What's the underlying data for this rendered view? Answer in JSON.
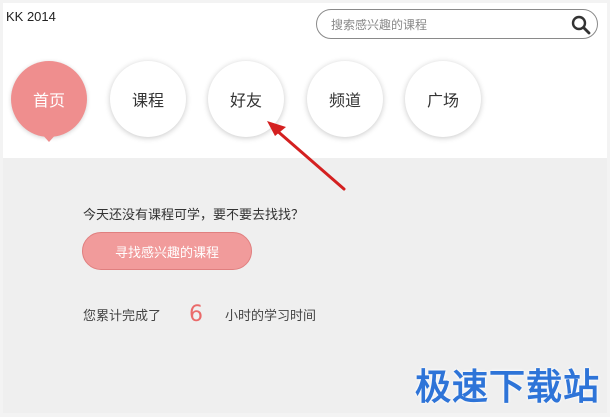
{
  "window": {
    "title": "KK 2014"
  },
  "search": {
    "placeholder": "搜索感兴趣的课程",
    "icon": "search-icon"
  },
  "nav": {
    "items": [
      {
        "label": "首页",
        "active": true
      },
      {
        "label": "课程",
        "active": false
      },
      {
        "label": "好友",
        "active": false
      },
      {
        "label": "频道",
        "active": false
      },
      {
        "label": "广场",
        "active": false
      }
    ]
  },
  "main": {
    "prompt": "今天还没有课程可学，要不要去找找？",
    "find_button": "寻找感兴趣的课程",
    "stats_prefix": "您累计完成了",
    "hours": "6",
    "stats_suffix": "小时的学习时间"
  },
  "watermark": "极速下载站",
  "colors": {
    "accent": "#ef8e8e",
    "button": "#f19b9b",
    "number": "#ea6a6a",
    "arrow": "#d42020",
    "watermark": "#2e74d8"
  }
}
